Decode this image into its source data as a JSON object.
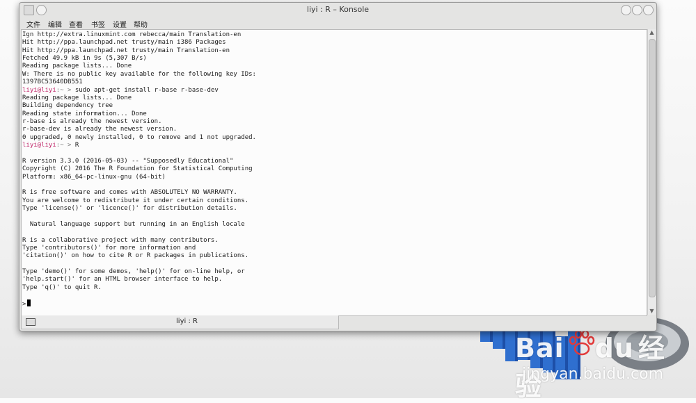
{
  "window": {
    "title": "liyi : R – Konsole",
    "menu": [
      "文件",
      "编辑",
      "查看",
      "书签",
      "设置",
      "帮助"
    ]
  },
  "terminal": {
    "lines": [
      {
        "text": "Ign http://extra.linuxmint.com rebecca/main Translation-en"
      },
      {
        "text": "Hit http://ppa.launchpad.net trusty/main i386 Packages"
      },
      {
        "text": "Hit http://ppa.launchpad.net trusty/main Translation-en"
      },
      {
        "text": "Fetched 49.9 kB in 9s (5,307 B/s)"
      },
      {
        "text": "Reading package lists... Done"
      },
      {
        "text": "W: There is no public key available for the following key IDs:"
      },
      {
        "text": "1397BC53640DB551"
      },
      {
        "user": "liyi@liyi",
        "path": ":~ > ",
        "cmd": "sudo apt-get install r-base r-base-dev"
      },
      {
        "text": "Reading package lists... Done"
      },
      {
        "text": "Building dependency tree"
      },
      {
        "text": "Reading state information... Done"
      },
      {
        "text": "r-base is already the newest version."
      },
      {
        "text": "r-base-dev is already the newest version."
      },
      {
        "text": "0 upgraded, 0 newly installed, 0 to remove and 1 not upgraded."
      },
      {
        "user": "liyi@liyi",
        "path": ":~ > ",
        "cmd": "R"
      },
      {
        "text": ""
      },
      {
        "text": "R version 3.3.0 (2016-05-03) -- \"Supposedly Educational\""
      },
      {
        "text": "Copyright (C) 2016 The R Foundation for Statistical Computing"
      },
      {
        "text": "Platform: x86_64-pc-linux-gnu (64-bit)"
      },
      {
        "text": ""
      },
      {
        "text": "R is free software and comes with ABSOLUTELY NO WARRANTY."
      },
      {
        "text": "You are welcome to redistribute it under certain conditions."
      },
      {
        "text": "Type 'license()' or 'licence()' for distribution details."
      },
      {
        "text": ""
      },
      {
        "text": "  Natural language support but running in an English locale"
      },
      {
        "text": ""
      },
      {
        "text": "R is a collaborative project with many contributors."
      },
      {
        "text": "Type 'contributors()' for more information and"
      },
      {
        "text": "'citation()' on how to cite R or R packages in publications."
      },
      {
        "text": ""
      },
      {
        "text": "Type 'demo()' for some demos, 'help()' for on-line help, or"
      },
      {
        "text": "'help.start()' for an HTML browser interface to help."
      },
      {
        "text": "Type 'q()' to quit R."
      },
      {
        "text": ""
      },
      {
        "prompt": ">"
      }
    ]
  },
  "tabs": [
    {
      "label": "liyi : R"
    }
  ],
  "watermark": {
    "brand": "Bai",
    "brand_suffix": "du",
    "cn": "经验",
    "url": "jingyan.baidu.com"
  },
  "colors": {
    "prompt_user": "#c0286a",
    "terminal_bg": "#fcfcfc",
    "window_frame": "#e4e4e3"
  }
}
